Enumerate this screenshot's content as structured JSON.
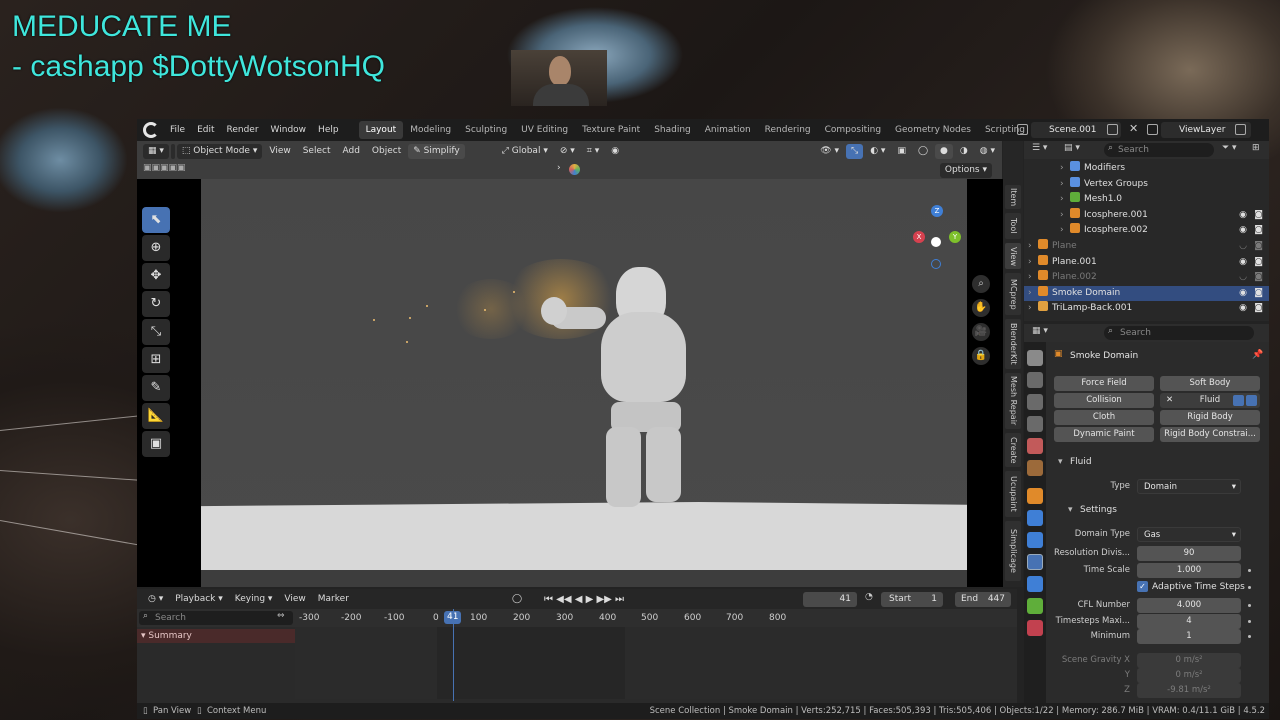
{
  "overlay": {
    "line1": "MEDUCATE ME",
    "line2": "- cashapp $DottyWotsonHQ"
  },
  "topbar": {
    "menus": [
      "File",
      "Edit",
      "Render",
      "Window",
      "Help"
    ],
    "workspaces": [
      "Layout",
      "Modeling",
      "Sculpting",
      "UV Editing",
      "Texture Paint",
      "Shading",
      "Animation",
      "Rendering",
      "Compositing",
      "Geometry Nodes",
      "Scripting"
    ],
    "active_workspace": "Layout",
    "scene": "Scene.001",
    "view_layer": "ViewLayer"
  },
  "viewport": {
    "mode": "Object Mode",
    "menus": [
      "View",
      "Select",
      "Add",
      "Object"
    ],
    "simplify": "Simplify",
    "transform": "Global",
    "options": "Options",
    "side_tabs": [
      "Item",
      "Tool",
      "View",
      "MCprep",
      "BlenderKit",
      "Mesh Repair",
      "Create",
      "Ucupaint",
      "Simplicage"
    ],
    "axis": {
      "x": "X",
      "y": "Y",
      "z": "Z"
    }
  },
  "timeline": {
    "menus": [
      "Playback",
      "Keying",
      "View",
      "Marker"
    ],
    "current_frame": "41",
    "start_label": "Start",
    "start": "1",
    "end_label": "End",
    "end": "447",
    "search_placeholder": "Search",
    "summary": "Summary",
    "ticks": [
      "-300",
      "-200",
      "-100",
      "0",
      "41",
      "100",
      "200",
      "300",
      "400",
      "500",
      "600",
      "700",
      "800"
    ]
  },
  "statusbar": {
    "pan": "Pan View",
    "context": "Context Menu",
    "info": "Scene Collection | Smoke Domain | Verts:252,715 | Faces:505,393 | Tris:505,406 | Objects:1/22 | Memory: 286.7 MiB | VRAM: 0.4/11.1 GiB | 4.5.2"
  },
  "outliner": {
    "search_placeholder": "Search",
    "rows": [
      {
        "label": "Modifiers",
        "dim": false,
        "sel": false
      },
      {
        "label": "Vertex Groups",
        "dim": false,
        "sel": false
      },
      {
        "label": "Mesh1.0",
        "dim": false,
        "sel": false
      },
      {
        "label": "Icosphere.001",
        "dim": false,
        "sel": false
      },
      {
        "label": "Icosphere.002",
        "dim": false,
        "sel": false
      },
      {
        "label": "Plane",
        "dim": true,
        "sel": false
      },
      {
        "label": "Plane.001",
        "dim": false,
        "sel": false
      },
      {
        "label": "Plane.002",
        "dim": true,
        "sel": false
      },
      {
        "label": "Smoke Domain",
        "dim": false,
        "sel": true
      },
      {
        "label": "TriLamp-Back.001",
        "dim": false,
        "sel": false
      }
    ]
  },
  "properties": {
    "search_placeholder": "Search",
    "object_name": "Smoke Domain",
    "physics_buttons": {
      "force_field": "Force Field",
      "soft_body": "Soft Body",
      "collision": "Collision",
      "fluid": "Fluid",
      "cloth": "Cloth",
      "rigid_body": "Rigid Body",
      "dynamic_paint": "Dynamic Paint",
      "rigid_body_constraint": "Rigid Body Constrai..."
    },
    "fluid_panel": "Fluid",
    "type_label": "Type",
    "type_value": "Domain",
    "settings_panel": "Settings",
    "domain_type_label": "Domain Type",
    "domain_type_value": "Gas",
    "resolution_label": "Resolution Divis...",
    "resolution_value": "90",
    "time_scale_label": "Time Scale",
    "time_scale_value": "1.000",
    "adaptive_label": "Adaptive Time Steps",
    "cfl_label": "CFL Number",
    "cfl_value": "4.000",
    "timesteps_label": "Timesteps Maxi...",
    "timesteps_value": "4",
    "minimum_label": "Minimum",
    "minimum_value": "1",
    "gravity_label": "Scene Gravity X",
    "gravity_x": "0 m/s²",
    "gravity_y_label": "Y",
    "gravity_y": "0 m/s²",
    "gravity_z_label": "Z",
    "gravity_z": "-9.81 m/s²"
  },
  "colors": {
    "accent": "#4772b3",
    "overlay_text": "#3fe6dc",
    "selection": "#334d80"
  }
}
